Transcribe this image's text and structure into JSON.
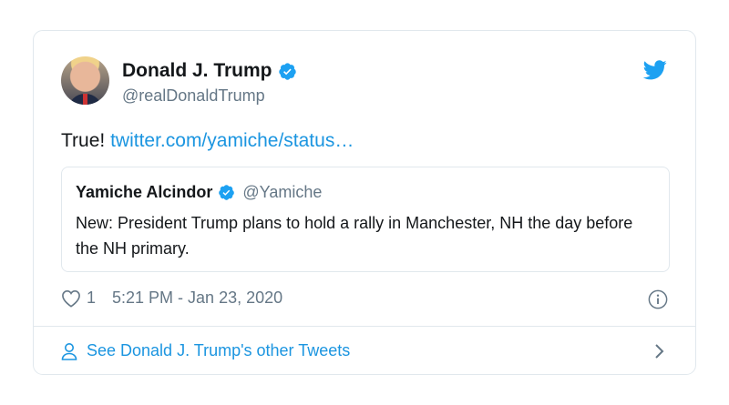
{
  "author": {
    "name": "Donald J. Trump",
    "handle": "@realDonaldTrump"
  },
  "tweet": {
    "text": "True!",
    "link": "twitter.com/yamiche/status…"
  },
  "quoted": {
    "name": "Yamiche Alcindor",
    "handle": "@Yamiche",
    "text": "New: President Trump plans to hold a rally in Manchester, NH the day before the NH primary."
  },
  "meta": {
    "likes": "1",
    "timestamp": "5:21 PM - Jan 23, 2020"
  },
  "footer": {
    "label": "See Donald J. Trump's other Tweets"
  },
  "icons": {
    "verified": "verified-badge-icon",
    "twitter": "twitter-bird-icon",
    "like": "heart-icon",
    "info": "info-icon",
    "profile": "person-icon",
    "chevron": "chevron-right-icon"
  },
  "colors": {
    "link": "#1b95e0",
    "secondary_text": "#657786",
    "border": "#e1e8ed"
  }
}
